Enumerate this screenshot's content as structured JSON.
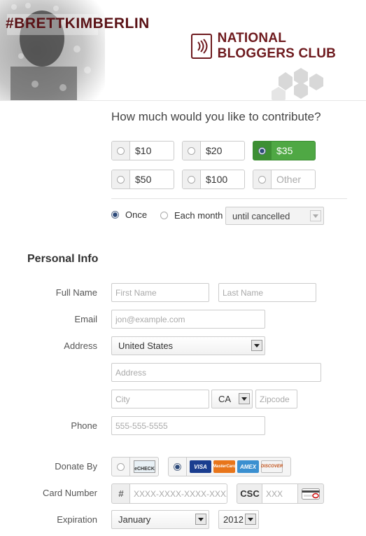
{
  "banner": {
    "hashtag": "#BRETTKIMBERLIN",
    "org_name": "NATIONAL BLOGGERS CLUB",
    "brand_color": "#6e1a1e"
  },
  "contribution": {
    "question": "How much would you like to contribute?",
    "amounts": [
      {
        "label": "$10",
        "selected": false
      },
      {
        "label": "$20",
        "selected": false
      },
      {
        "label": "$35",
        "selected": true
      },
      {
        "label": "$50",
        "selected": false
      },
      {
        "label": "$100",
        "selected": false
      },
      {
        "label": "Other",
        "selected": false
      }
    ],
    "accent_color": "#4fa844",
    "frequency": {
      "once_label": "Once",
      "monthly_label": "Each month",
      "selected": "once",
      "duration_value": "until cancelled"
    }
  },
  "personal_info": {
    "title": "Personal Info",
    "full_name_label": "Full Name",
    "first_name_placeholder": "First Name",
    "last_name_placeholder": "Last Name",
    "email_label": "Email",
    "email_placeholder": "jon@example.com",
    "address_label": "Address",
    "country_value": "United States",
    "address_placeholder": "Address",
    "city_placeholder": "City",
    "state_value": "CA",
    "zip_placeholder": "Zipcode",
    "phone_label": "Phone",
    "phone_placeholder": "555-555-5555"
  },
  "payment": {
    "donate_by_label": "Donate By",
    "echeck_label": "eCHECK",
    "cards": [
      "VISA",
      "MasterCard",
      "AMEX",
      "DISCOVER"
    ],
    "selected": "card",
    "card_number_label": "Card Number",
    "card_prefix": "#",
    "card_placeholder": "XXXX-XXXX-XXXX-XXXX",
    "csc_label": "CSC",
    "csc_placeholder": "XXX",
    "expiration_label": "Expiration",
    "month_value": "January",
    "year_value": "2012"
  }
}
